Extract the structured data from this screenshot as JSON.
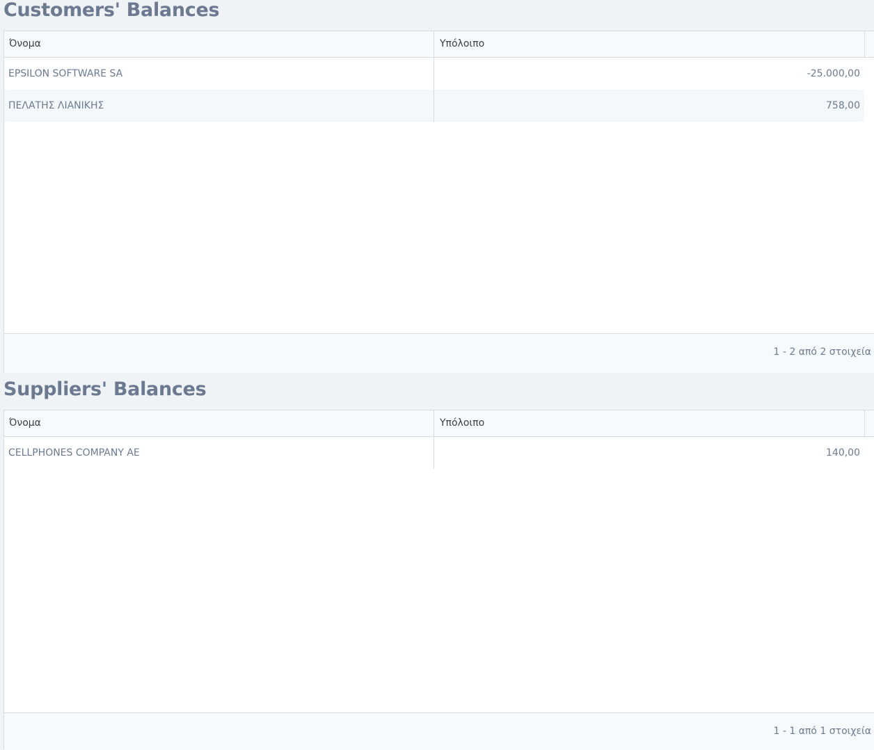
{
  "customers": {
    "title": "Customers' Balances",
    "columns": {
      "name": "Όνομα",
      "balance": "Υπόλοιπο"
    },
    "rows": [
      {
        "name": "EPSILON SOFTWARE SA",
        "balance": "-25.000,00"
      },
      {
        "name": "ΠΕΛΑΤΗΣ ΛΙΑΝΙΚΗΣ",
        "balance": "758,00"
      }
    ],
    "pager": "1 - 2 από 2 στοιχεία"
  },
  "suppliers": {
    "title": "Suppliers' Balances",
    "columns": {
      "name": "Όνομα",
      "balance": "Υπόλοιπο"
    },
    "rows": [
      {
        "name": "CELLPHONES COMPANY AE",
        "balance": "140,00"
      }
    ],
    "pager": "1 - 1 από 1 στοιχεία"
  }
}
